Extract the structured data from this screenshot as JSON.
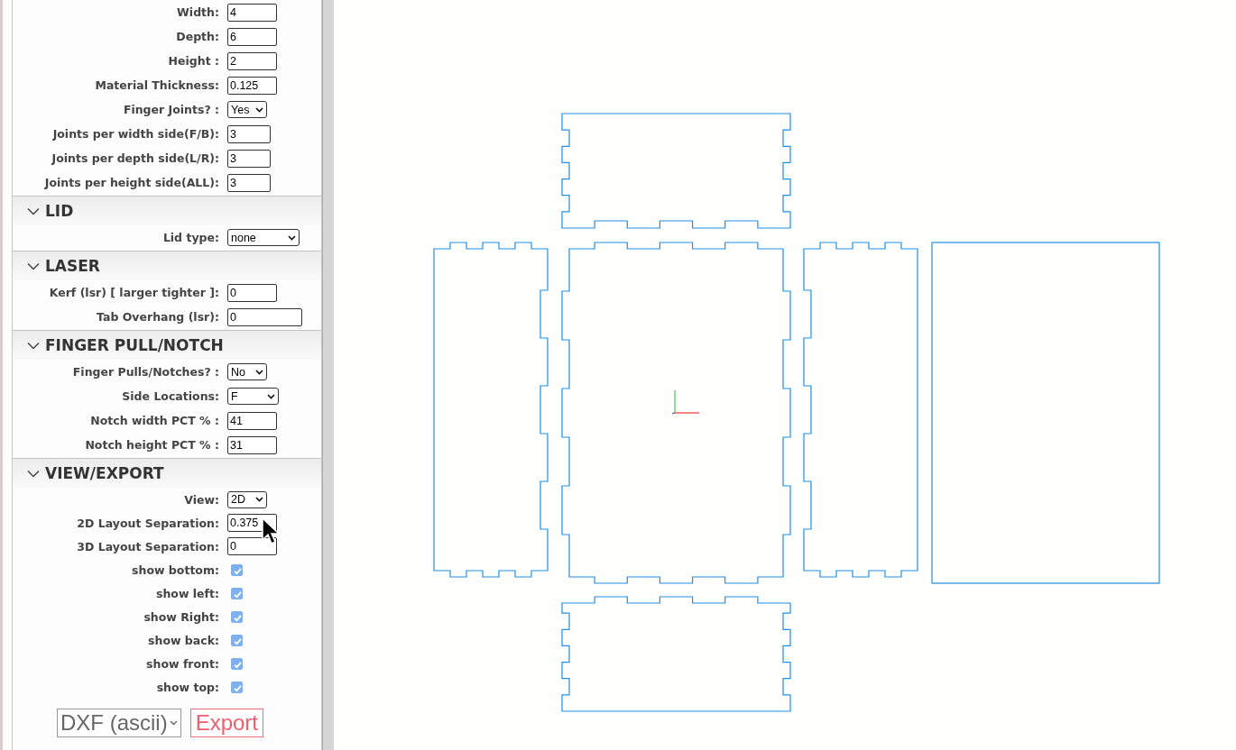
{
  "sections": [
    {
      "rows": [
        {
          "kind": "text",
          "label": "Width:",
          "value": "4"
        },
        {
          "kind": "text",
          "label": "Depth:",
          "value": "6"
        },
        {
          "kind": "text",
          "label": "Height :",
          "value": "2"
        },
        {
          "kind": "text",
          "label": "Material Thickness:",
          "value": "0.125"
        },
        {
          "kind": "select",
          "label": "Finger Joints? :",
          "value": "Yes"
        },
        {
          "kind": "text",
          "label": "Joints per width side(F/B):",
          "value": "3"
        },
        {
          "kind": "text",
          "label": "Joints per depth side(L/R):",
          "value": "3"
        },
        {
          "kind": "text",
          "label": "Joints per height side(ALL):",
          "value": "3"
        }
      ]
    },
    {
      "title": "LID",
      "expanded": true,
      "rows": [
        {
          "kind": "select",
          "label": "Lid type:",
          "value": "none"
        }
      ]
    },
    {
      "title": "LASER",
      "expanded": true,
      "rows": [
        {
          "kind": "text",
          "label": "Kerf (lsr) [ larger tighter ]:",
          "value": "0"
        },
        {
          "kind": "text",
          "label": "Tab Overhang (lsr):",
          "value": "0"
        }
      ]
    },
    {
      "title": "FINGER PULL/NOTCH",
      "expanded": true,
      "rows": [
        {
          "kind": "select",
          "label": "Finger Pulls/Notches? :",
          "value": "No"
        },
        {
          "kind": "select",
          "label": "Side Locations:",
          "value": "F"
        },
        {
          "kind": "text",
          "label": "Notch width PCT % :",
          "value": "41"
        },
        {
          "kind": "text",
          "label": "Notch height PCT % :",
          "value": "31"
        }
      ]
    },
    {
      "title": "VIEW/EXPORT",
      "expanded": true,
      "rows": [
        {
          "kind": "select",
          "label": "View:",
          "value": "2D"
        },
        {
          "kind": "text",
          "label": "2D Layout Separation:",
          "value": "0.375"
        },
        {
          "kind": "text",
          "label": "3D Layout Separation:",
          "value": "0"
        },
        {
          "kind": "checkbox",
          "label": "show bottom:",
          "checked": true
        },
        {
          "kind": "checkbox",
          "label": "show left:",
          "checked": true
        },
        {
          "kind": "checkbox",
          "label": "show Right:",
          "checked": true
        },
        {
          "kind": "checkbox",
          "label": "show back:",
          "checked": true
        },
        {
          "kind": "checkbox",
          "label": "show front:",
          "checked": true
        },
        {
          "kind": "checkbox",
          "label": "show top:",
          "checked": true
        }
      ]
    }
  ],
  "export": {
    "format": "DXF (ascii)",
    "button": "Export"
  }
}
